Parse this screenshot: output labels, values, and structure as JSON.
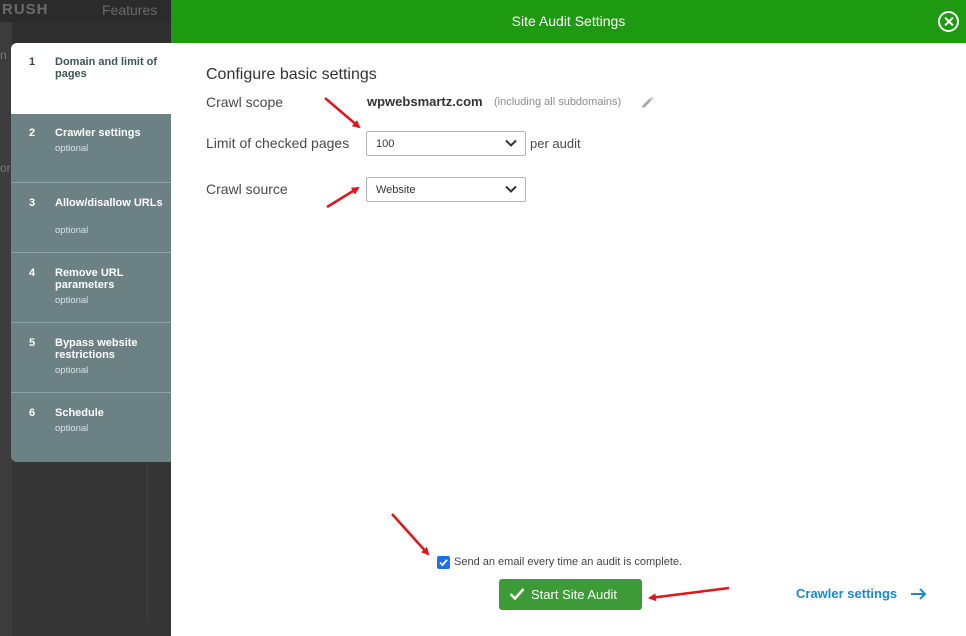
{
  "background": {
    "logo": "RUSH",
    "nav_features": "Features",
    "left_snippets": [
      "n",
      "or"
    ]
  },
  "steps": [
    {
      "num": "1",
      "title": "Domain and limit of pages",
      "optional": "",
      "active": true
    },
    {
      "num": "2",
      "title": "Crawler settings",
      "optional": "optional",
      "active": false
    },
    {
      "num": "3",
      "title": "Allow/disallow URLs",
      "optional": "optional",
      "active": false
    },
    {
      "num": "4",
      "title": "Remove URL parameters",
      "optional": "optional",
      "active": false
    },
    {
      "num": "5",
      "title": "Bypass website restrictions",
      "optional": "optional",
      "active": false
    },
    {
      "num": "6",
      "title": "Schedule",
      "optional": "optional",
      "active": false
    }
  ],
  "modal": {
    "title": "Site Audit Settings",
    "section_title": "Configure basic settings",
    "crawl_scope": {
      "label": "Crawl scope",
      "domain": "wpwebsmartz.com",
      "note": "(including all subdomains)"
    },
    "limit": {
      "label": "Limit of checked pages",
      "value": "100",
      "suffix": "per audit"
    },
    "source": {
      "label": "Crawl source",
      "value": "Website"
    },
    "email_checkbox": {
      "label": "Send an email every time an audit is complete.",
      "checked": true
    },
    "start_button": "Start Site Audit",
    "crawler_link": "Crawler settings"
  },
  "colors": {
    "header_green": "#1d9a0f",
    "button_green": "#3c9b36",
    "link_blue": "#1e89c9",
    "sidebar_gray": "#6c8184",
    "annotation_red": "#e0161b"
  }
}
